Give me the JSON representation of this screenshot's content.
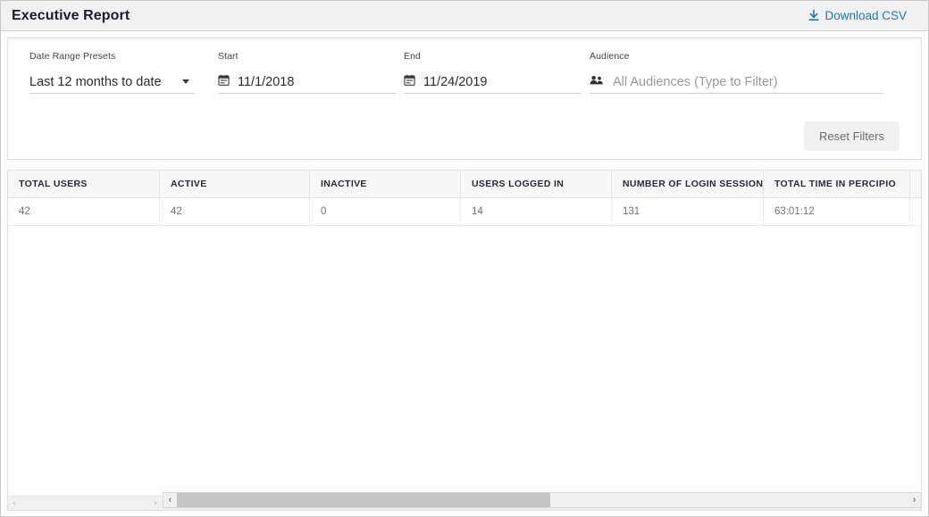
{
  "header": {
    "title": "Executive Report",
    "download_label": "Download CSV",
    "download_icon": "download-icon",
    "link_color": "#1878c7",
    "bar_bg": "#f1f1f1"
  },
  "filters": {
    "preset": {
      "label": "Date Range Presets",
      "value": "Last 12 months to date",
      "icon": "chevron-down-icon"
    },
    "start": {
      "label": "Start",
      "value": "11/1/2018",
      "icon": "calendar-icon"
    },
    "end": {
      "label": "End",
      "value": "11/24/2019",
      "icon": "calendar-icon"
    },
    "audience": {
      "label": "Audience",
      "placeholder": "All Audiences (Type to Filter)",
      "value": "",
      "icon": "people-icon"
    },
    "reset_label": "Reset Filters"
  },
  "table": {
    "columns": [
      "TOTAL USERS",
      "ACTIVE",
      "INACTIVE",
      "USERS LOGGED IN",
      "NUMBER OF LOGIN SESSIONS",
      "TOTAL TIME IN PERCIPIO"
    ],
    "rows": [
      [
        "42",
        "42",
        "0",
        "14",
        "131",
        "63:01:12"
      ]
    ]
  },
  "scrollbars": {
    "left_arrow": "‹",
    "right_arrow": "›"
  }
}
